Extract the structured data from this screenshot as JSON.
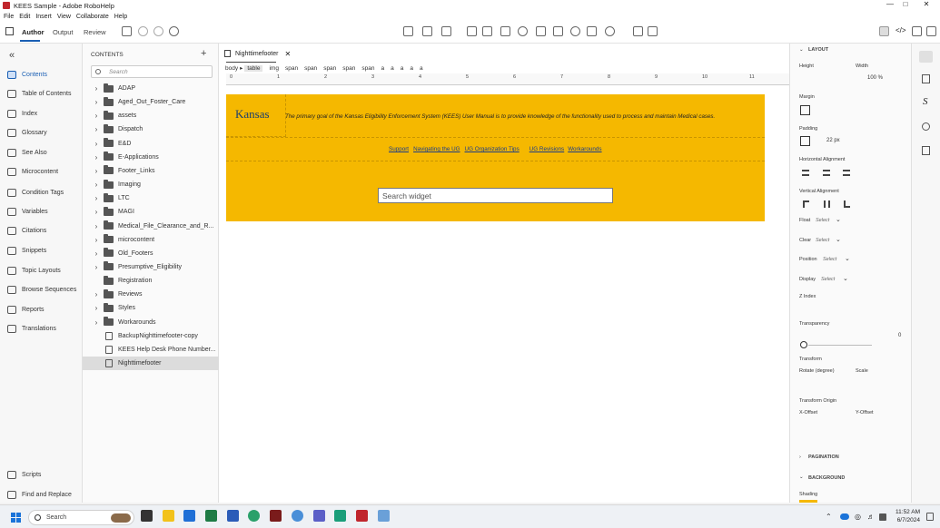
{
  "window": {
    "title": "KEES Sample - Adobe RoboHelp"
  },
  "menu": [
    "File",
    "Edit",
    "Insert",
    "View",
    "Collaborate",
    "Help"
  ],
  "modes": {
    "author": "Author",
    "output": "Output",
    "review": "Review"
  },
  "leftnav": {
    "items": [
      "Contents",
      "Table of Contents",
      "Index",
      "Glossary",
      "See Also",
      "Microcontent",
      "Condition Tags",
      "Variables",
      "Citations",
      "Snippets",
      "Topic Layouts",
      "Browse Sequences",
      "Reports",
      "Translations"
    ],
    "bottom_items": [
      "Scripts",
      "Find and Replace"
    ]
  },
  "contents_panel": {
    "title": "CONTENTS",
    "search_placeholder": "Search",
    "folders": [
      "ADAP",
      "Aged_Out_Foster_Care",
      "assets",
      "Dispatch",
      "E&D",
      "E-Applications",
      "Footer_Links",
      "Imaging",
      "LTC",
      "MAGI",
      "Medical_File_Clearance_and_R...",
      "microcontent",
      "Old_Footers",
      "Presumptive_Eligibility",
      "Registration",
      "Reviews",
      "Styles",
      "Workarounds"
    ],
    "files": [
      "BackupNighttimefooter-copy",
      "KEES Help Desk Phone Number...",
      "Nighttimefooter"
    ]
  },
  "editor": {
    "tab_title": "Nighttimefooter",
    "breadcrumb": [
      "body",
      "table",
      "img",
      "span",
      "span",
      "span",
      "span",
      "span",
      "a",
      "a",
      "a",
      "a",
      "a"
    ],
    "ruler_numbers": [
      "0",
      "1",
      "2",
      "3",
      "4",
      "5",
      "6",
      "7",
      "8",
      "9",
      "10",
      "11"
    ],
    "logo_text": "Kansas",
    "intro_text": "The primary goal of the Kansas Eligibility Enforcement System (KEES) User Manual is to provide knowledge of the functionality used to process and maintain Medical cases.",
    "links": [
      "Support",
      "Navigating the UG",
      "UG Organization Tips",
      "UG Revisions",
      "Workarounds"
    ],
    "search_widget": "Search widget"
  },
  "properties": {
    "layout_header": "LAYOUT",
    "height_label": "Height",
    "width_label": "Width",
    "width_value": "100 %",
    "margin_label": "Margin",
    "padding_label": "Padding",
    "padding_value": "22 px",
    "h_align_label": "Horizontal Alignment",
    "v_align_label": "Vertical Alignment",
    "float_label": "Float",
    "clear_label": "Clear",
    "position_label": "Position",
    "display_label": "Display",
    "select_text": "Select",
    "zindex_label": "Z Index",
    "transparency_label": "Transparency",
    "transparency_value": "0",
    "transform_label": "Transform",
    "rotate_label": "Rotate (degree)",
    "scale_label": "Scale",
    "transform_origin_label": "Transform Origin",
    "xoffset_label": "X-Offset",
    "yoffset_label": "Y-Offset",
    "pagination_header": "PAGINATION",
    "background_header": "BACKGROUND",
    "shading_label": "Shading"
  },
  "taskbar": {
    "search_placeholder": "Search",
    "time": "11:52 AM",
    "date": "6/7/2024"
  },
  "colors": {
    "accent": "#1a5fb4",
    "doc_background": "#f5b800",
    "app_red": "#c0262d"
  }
}
